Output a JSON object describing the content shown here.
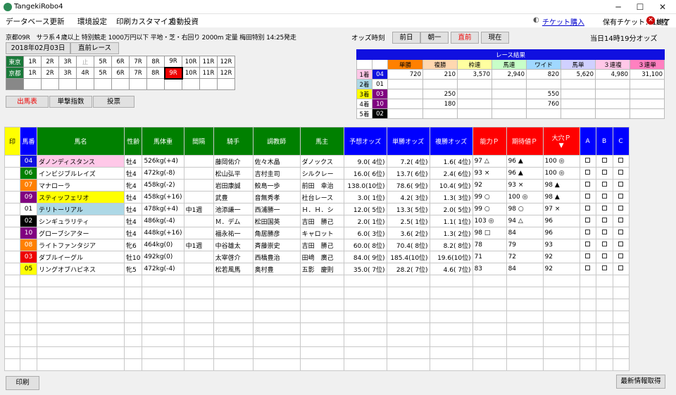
{
  "window": {
    "title": "TangekiRobo4"
  },
  "menu": [
    "データベース更新",
    "環境設定",
    "印刷カスタマイズ",
    "自動投資"
  ],
  "ticket": {
    "link": "チケット購入",
    "owned": "保有チケット：18枚",
    "exit": "終了"
  },
  "race": {
    "info": "京都09R　サラ系４歳以上 特別競走 1000万円以下 平地・芝・右回り 2000m 定量 梅田特別 14:25発走",
    "date": "2018年02月03日",
    "prev_race": "直前レース"
  },
  "venues": [
    {
      "name": "東京",
      "races": [
        "1R",
        "2R",
        "3R",
        "止",
        "5R",
        "6R",
        "7R",
        "8R",
        "9R",
        "10R",
        "11R",
        "12R"
      ],
      "disabled": [
        3
      ],
      "selected": -1
    },
    {
      "name": "京都",
      "races": [
        "1R",
        "2R",
        "3R",
        "4R",
        "5R",
        "6R",
        "7R",
        "8R",
        "9R",
        "10R",
        "11R",
        "12R"
      ],
      "disabled": [],
      "selected": 8
    },
    {
      "name": "",
      "races": [
        "",
        "",
        "",
        "",
        "",
        "",
        "",
        "",
        "",
        "",
        "",
        ""
      ],
      "disabled": [],
      "selected": -1
    }
  ],
  "tabs": [
    "出馬表",
    "単撃指数",
    "投票"
  ],
  "odds_time": {
    "label": "オッズ時刻",
    "buttons": [
      "前日",
      "朝一",
      "直前",
      "現在"
    ],
    "active": 2,
    "current": "当日14時19分オッズ"
  },
  "result": {
    "title": "レース結果",
    "headers": [
      "単勝",
      "複勝",
      "枠連",
      "馬連",
      "ワイド",
      "馬単",
      "３連複",
      "３連単"
    ],
    "header_colors": [
      "#ff8000",
      "#ffd8b0",
      "#ffffa0",
      "#c8ffc8",
      "#a0d8ff",
      "#d0d0ff",
      "#ffc8e8",
      "#ff80c0"
    ],
    "rows": [
      {
        "place": "1着",
        "num": "04",
        "num_bg": "#1010e0",
        "num_fg": "#fff",
        "vals": [
          "720",
          "210",
          "3,570",
          "2,940",
          "820",
          "5,620",
          "4,980",
          "31,100"
        ]
      },
      {
        "place": "2着",
        "num": "01",
        "num_bg": "#fff",
        "num_fg": "#000",
        "vals": [
          "",
          "",
          "",
          "",
          "",
          "",
          "",
          ""
        ]
      },
      {
        "place": "3着",
        "num": "03",
        "num_bg": "#800080",
        "num_fg": "#fff",
        "vals": [
          "",
          "250",
          "",
          "",
          "550",
          "",
          "",
          ""
        ]
      },
      {
        "place": "4着",
        "num": "10",
        "num_bg": "#800080",
        "num_fg": "#fff",
        "vals": [
          "",
          "180",
          "",
          "",
          "760",
          "",
          "",
          ""
        ]
      },
      {
        "place": "5着",
        "num": "02",
        "num_bg": "#000",
        "num_fg": "#fff",
        "vals": [
          "",
          "",
          "",
          "",
          "",
          "",
          "",
          ""
        ]
      }
    ],
    "place_colors": [
      "#ffc8e8",
      "#add8e6",
      "#ffff00",
      "#fff",
      "#fff"
    ]
  },
  "table": {
    "headers": [
      "印",
      "馬番",
      "馬名",
      "性齢",
      "馬体重",
      "間隔",
      "騎手",
      "調教師",
      "馬主",
      "予想オッズ",
      "単勝オッズ",
      "複勝オッズ",
      "能力Ｐ",
      "期待値Ｐ",
      "大穴Ｐ",
      "A",
      "B",
      "C"
    ],
    "header_bg": [
      "#ffff00",
      "#0000ff",
      "#008000",
      "#008000",
      "#008000",
      "#008000",
      "#008000",
      "#008000",
      "#008000",
      "#0000ff",
      "#0000ff",
      "#0000ff",
      "#ff0000",
      "#ff0000",
      "#ff0000",
      "#0000ff",
      "#0000ff",
      "#0000ff"
    ],
    "header_fg": [
      "#000",
      "#fff",
      "#fff",
      "#fff",
      "#fff",
      "#fff",
      "#fff",
      "#fff",
      "#fff",
      "#fff",
      "#fff",
      "#fff",
      "#fff",
      "#fff",
      "#fff",
      "#fff",
      "#fff",
      "#fff"
    ],
    "sort_marker": "▼",
    "rows": [
      {
        "num": "04",
        "num_bg": "#1010e0",
        "num_fg": "#fff",
        "name": "ダノンディスタンス",
        "name_bg": "#ffc8e8",
        "sex": "牡4",
        "weight": "526kg(+4)",
        "interval": "",
        "jockey": "藤岡佑介",
        "trainer": "佐々木晶",
        "owner": "ダノックス",
        "pred": "9.0( 4位)",
        "win": "7.2( 4位)",
        "place": "1.6( 4位)",
        "ab": "97 △",
        "ev": "96 ▲",
        "dh": "100 ◎"
      },
      {
        "num": "06",
        "num_bg": "#008000",
        "num_fg": "#fff",
        "name": "インビジブルレイズ",
        "name_bg": "#fff",
        "sex": "牡4",
        "weight": "472kg(-8)",
        "interval": "",
        "jockey": "松山弘平",
        "trainer": "吉村圭司",
        "owner": "シルクレー",
        "pred": "16.0( 6位)",
        "win": "13.7( 6位)",
        "place": "2.4( 6位)",
        "ab": "93 ×",
        "ev": "96 ▲",
        "dh": "100 ◎"
      },
      {
        "num": "07",
        "num_bg": "#ff8000",
        "num_fg": "#fff",
        "name": "マナローラ",
        "name_bg": "#fff",
        "sex": "牝4",
        "weight": "458kg(-2)",
        "interval": "",
        "jockey": "岩田康誠",
        "trainer": "鮫島一歩",
        "owner": "前田　幸治",
        "pred": "138.0(10位)",
        "win": "78.6( 9位)",
        "place": "10.4( 9位)",
        "ab": "92",
        "ev": "93 ×",
        "dh": "98 ▲"
      },
      {
        "num": "09",
        "num_bg": "#800080",
        "num_fg": "#fff",
        "name": "スティッフェリオ",
        "name_bg": "#ffff00",
        "sex": "牡4",
        "weight": "458kg(+16)",
        "interval": "",
        "jockey": "武豊",
        "trainer": "音無秀孝",
        "owner": "社台レース",
        "pred": "3.0( 1位)",
        "win": "4.2( 3位)",
        "place": "1.3( 3位)",
        "ab": "99 ○",
        "ev": "100 ◎",
        "dh": "98 ▲"
      },
      {
        "num": "01",
        "num_bg": "#fff",
        "num_fg": "#000",
        "name": "テリトーリアル",
        "name_bg": "#add8e6",
        "sex": "牡4",
        "weight": "478kg(+4)",
        "interval": "中1週",
        "jockey": "池添謙一",
        "trainer": "西浦勝一",
        "owner": "Ｈ．Ｈ．シ",
        "pred": "12.0( 5位)",
        "win": "13.3( 5位)",
        "place": "2.0( 5位)",
        "ab": "99 ○",
        "ev": "98 ○",
        "dh": "97 ×"
      },
      {
        "num": "02",
        "num_bg": "#000",
        "num_fg": "#fff",
        "name": "シンギュラリティ",
        "name_bg": "#fff",
        "sex": "牡4",
        "weight": "486kg(-4)",
        "interval": "",
        "jockey": "Ｍ．デム",
        "trainer": "松田国英",
        "owner": "吉田　勝己",
        "pred": "2.0( 1位)",
        "win": "2.5( 1位)",
        "place": "1.1( 1位)",
        "ab": "103 ◎",
        "ev": "94 △",
        "dh": "96"
      },
      {
        "num": "10",
        "num_bg": "#800080",
        "num_fg": "#fff",
        "name": "グローブシアター",
        "name_bg": "#fff",
        "sex": "牡4",
        "weight": "448kg(+16)",
        "interval": "",
        "jockey": "福永祐一",
        "trainer": "角居勝彦",
        "owner": "キャロット",
        "pred": "6.0( 3位)",
        "win": "3.6( 2位)",
        "place": "1.3( 2位)",
        "ab": "98 □",
        "ev": "84",
        "dh": "96"
      },
      {
        "num": "08",
        "num_bg": "#ff8000",
        "num_fg": "#fff",
        "name": "ライトファンタジア",
        "name_bg": "#fff",
        "sex": "牝6",
        "weight": "464kg(0)",
        "interval": "中1週",
        "jockey": "中谷雄太",
        "trainer": "斉藤崇史",
        "owner": "吉田　勝己",
        "pred": "60.0( 8位)",
        "win": "70.4( 8位)",
        "place": "8.2( 8位)",
        "ab": "78",
        "ev": "79",
        "dh": "93"
      },
      {
        "num": "03",
        "num_bg": "#e00",
        "num_fg": "#fff",
        "name": "ダブルイーグル",
        "name_bg": "#fff",
        "sex": "牡10",
        "weight": "492kg(0)",
        "interval": "",
        "jockey": "太宰啓介",
        "trainer": "西橋豊治",
        "owner": "田﨑　廣己",
        "pred": "84.0( 9位)",
        "win": "185.4(10位)",
        "place": "19.6(10位)",
        "ab": "71",
        "ev": "72",
        "dh": "92"
      },
      {
        "num": "05",
        "num_bg": "#ffff00",
        "num_fg": "#000",
        "name": "リングオブハピネス",
        "name_bg": "#fff",
        "sex": "牝5",
        "weight": "472kg(-4)",
        "interval": "",
        "jockey": "松若風馬",
        "trainer": "奥村豊",
        "owner": "五影　慶則",
        "pred": "35.0( 7位)",
        "win": "28.2( 7位)",
        "place": "4.6( 7位)",
        "ab": "83",
        "ev": "84",
        "dh": "92"
      }
    ],
    "empty_rows": 8
  },
  "footer": {
    "print": "印刷",
    "refresh": "最新情報取得"
  }
}
